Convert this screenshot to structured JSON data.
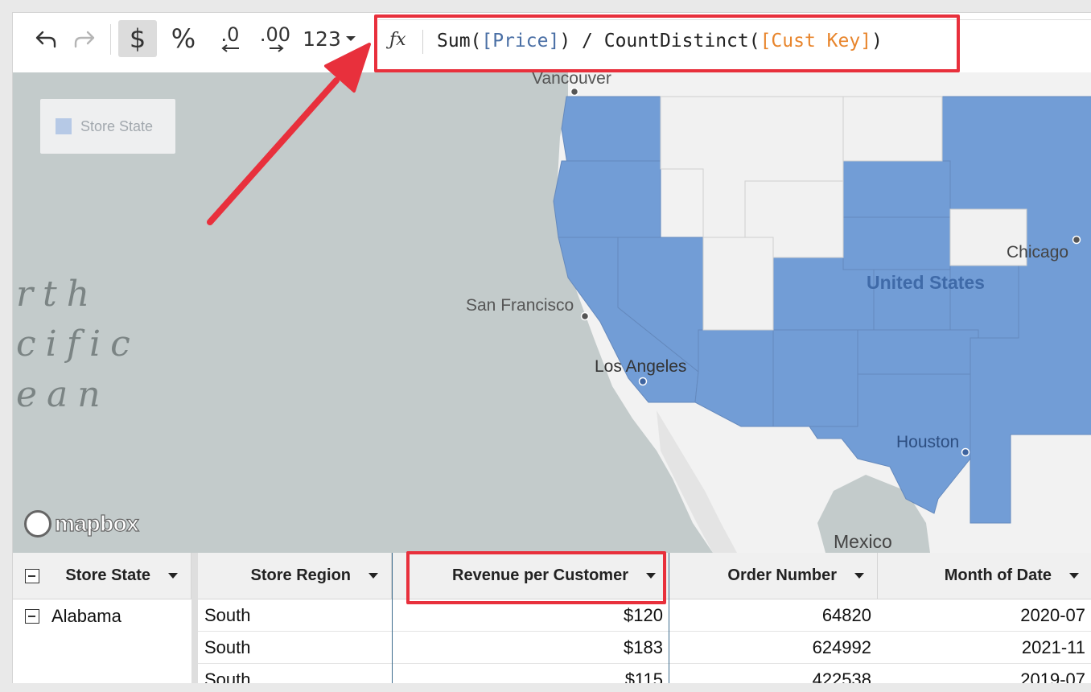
{
  "toolbar": {
    "undo_icon": "undo-icon",
    "redo_icon": "redo-icon",
    "currency_label": "$",
    "percent_label": "%",
    "decrease_decimals_label": ".0",
    "increase_decimals_label": ".00",
    "number_format_label": "123"
  },
  "formula_bar": {
    "fx_label": "ƒx",
    "formula_prefix": "Sum(",
    "formula_ref1": "[Price]",
    "formula_middle": ") / CountDistinct(",
    "formula_ref2": "[Cust Key]",
    "formula_suffix": ")"
  },
  "map": {
    "legend_label": "Store State",
    "legend_color": "#b6c9e6",
    "highlight_color": "#729dd6",
    "ocean_lines": [
      "rth",
      "cific",
      "ean"
    ],
    "cities": [
      "Vancouver",
      "San Francisco",
      "Los Angeles",
      "Chicago",
      "Houston"
    ],
    "country_label": "United States",
    "mexico_label": "Mexico",
    "attribution": "mapbox"
  },
  "table": {
    "columns": [
      "Store State",
      "Store Region",
      "Revenue per Customer",
      "Order Number",
      "Month of Date"
    ],
    "group_label": "Alabama",
    "rows": [
      {
        "region": "South",
        "revenue": "$120",
        "order": "64820",
        "month": "2020-07"
      },
      {
        "region": "South",
        "revenue": "$183",
        "order": "624992",
        "month": "2021-11"
      },
      {
        "region": "South",
        "revenue": "$115",
        "order": "422538",
        "month": "2019-07"
      }
    ]
  },
  "annotations": {
    "highlight_color": "#e8303c"
  }
}
